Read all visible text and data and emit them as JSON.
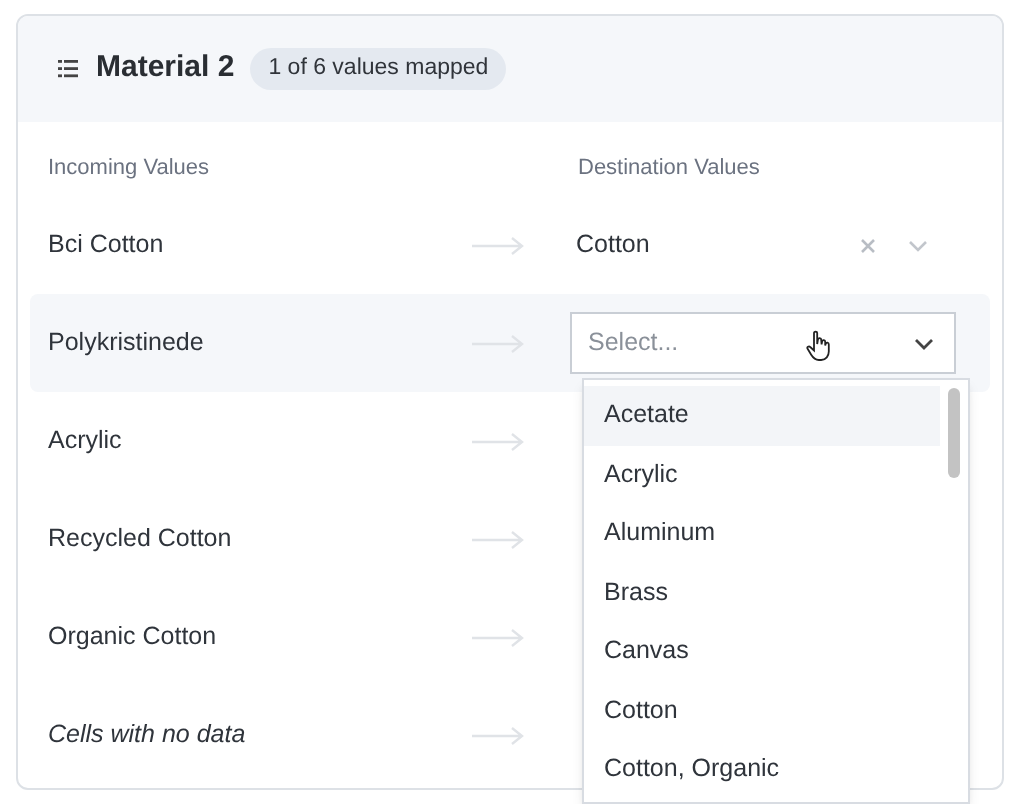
{
  "section": {
    "title": "Material 2",
    "badge": "1 of 6 values mapped"
  },
  "columns": [
    "Incoming Values",
    "Destination Values"
  ],
  "rows": [
    {
      "incoming": "Bci Cotton",
      "italic": false,
      "kind": "mapped",
      "value": "Cotton"
    },
    {
      "incoming": "Polykristinede",
      "italic": false,
      "kind": "open_select",
      "placeholder": "Select..."
    },
    {
      "incoming": "Acrylic",
      "italic": false,
      "kind": "unmapped"
    },
    {
      "incoming": "Recycled Cotton",
      "italic": false,
      "kind": "unmapped"
    },
    {
      "incoming": "Organic Cotton",
      "italic": false,
      "kind": "unmapped"
    },
    {
      "incoming": "Cells with no data",
      "italic": true,
      "kind": "unmapped"
    }
  ],
  "dropdown": {
    "options": [
      {
        "label": "Acetate",
        "selected": true
      },
      {
        "label": "Acrylic",
        "selected": false
      },
      {
        "label": "Aluminum",
        "selected": false
      },
      {
        "label": "Brass",
        "selected": false
      },
      {
        "label": "Canvas",
        "selected": false
      },
      {
        "label": "Cotton",
        "selected": false
      },
      {
        "label": "Cotton, Organic",
        "selected": false
      }
    ]
  }
}
